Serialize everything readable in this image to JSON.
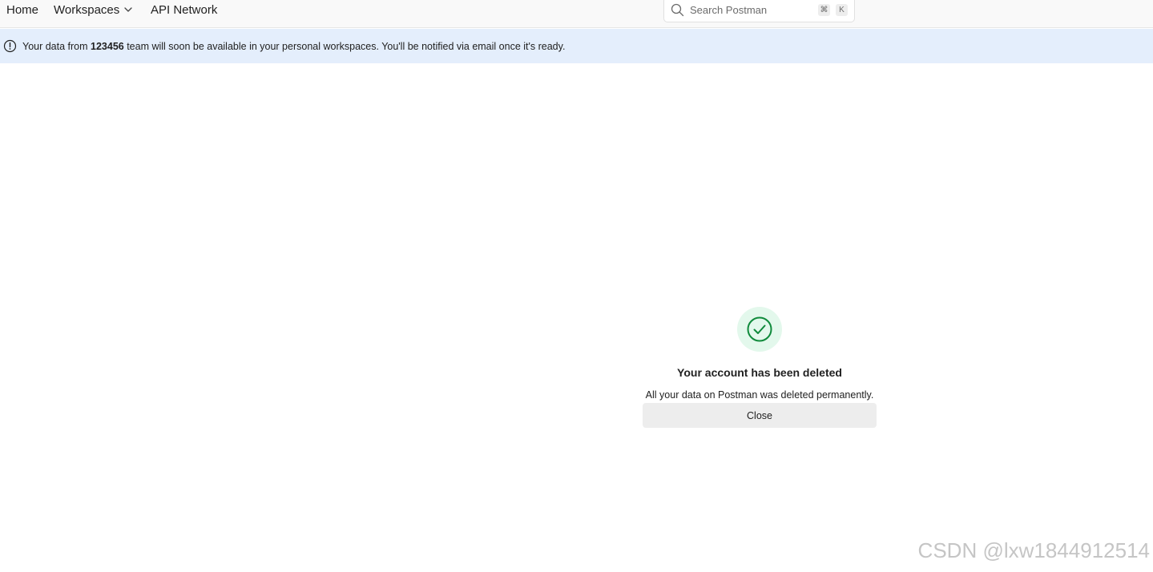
{
  "nav": {
    "home": "Home",
    "workspaces": "Workspaces",
    "api_network": "API Network",
    "icons": {
      "workspaces_dropdown": "chevron-down-icon"
    }
  },
  "search": {
    "placeholder": "Search Postman",
    "shortcut_cmd": "⌘",
    "shortcut_key": "K",
    "icon": "search-icon"
  },
  "banner": {
    "icon": "info-circle-icon",
    "text_before": "Your data from ",
    "team_name": "123456",
    "text_after": " team will soon be available in your personal workspaces. You'll be notified via email once it's ready.",
    "background": "#e4eefc"
  },
  "dialog": {
    "icon": "check-circle-icon",
    "title": "Your account has been deleted",
    "description": "All your data on Postman was deleted permanently.",
    "close_label": "Close",
    "success_color": "#0f8a3b",
    "success_bg": "#e3f8ec"
  },
  "watermark": "CSDN @lxw1844912514"
}
